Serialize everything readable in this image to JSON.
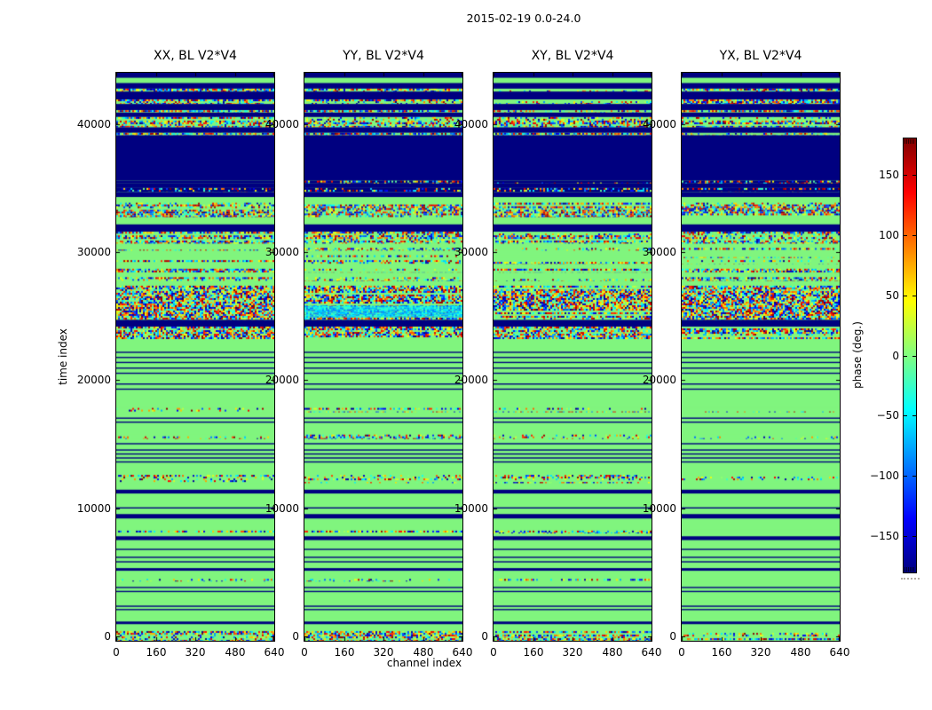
{
  "figure": {
    "title": "2015-02-19 0.0-24.0",
    "xlabel": "channel index",
    "ylabel": "time index"
  },
  "chart_data": {
    "type": "heatmap",
    "title": "2015-02-19 0.0-24.0",
    "xlabel": "channel index",
    "ylabel": "time index",
    "xlim": [
      0,
      640
    ],
    "ylim": [
      0,
      44000
    ],
    "x_ticks": [
      0,
      160,
      320,
      480,
      640
    ],
    "y_ticks": [
      0,
      10000,
      20000,
      30000,
      40000
    ],
    "grid": false,
    "panels": [
      {
        "label": "XX, BL V2*V4",
        "seed": 101
      },
      {
        "label": "YY, BL V2*V4",
        "seed": 202
      },
      {
        "label": "XY, BL V2*V4",
        "seed": 303
      },
      {
        "label": "YX, BL V2*V4",
        "seed": 404
      }
    ],
    "colorbar": {
      "label": "phase (deg.)",
      "vmin": -180,
      "vmax": 180,
      "ticks": [
        150,
        100,
        50,
        0,
        -50,
        -100,
        -150
      ],
      "colormap": "jet"
    },
    "colors": {
      "phase_zero_green": "#80f57e",
      "phase_neg180_navy": "#000080"
    },
    "bands": [
      {
        "t0": 43850,
        "t1": 44250,
        "type": "blue"
      },
      {
        "t0": 43450,
        "t1": 43850,
        "type": "green"
      },
      {
        "t0": 43010,
        "t1": 43450,
        "type": "blue"
      },
      {
        "t0": 42790,
        "t1": 43010,
        "type": "speckle"
      },
      {
        "t0": 42170,
        "t1": 42790,
        "type": "blue"
      },
      {
        "t0": 41820,
        "t1": 42170,
        "type": "speckle"
      },
      {
        "t0": 41330,
        "t1": 41820,
        "type": "blue"
      },
      {
        "t0": 41150,
        "t1": 41330,
        "type": "speckle"
      },
      {
        "t0": 40800,
        "t1": 41150,
        "type": "blue"
      },
      {
        "t0": 40000,
        "t1": 40800,
        "type": "speckle"
      },
      {
        "t0": 39560,
        "t1": 40000,
        "type": "blue"
      },
      {
        "t0": 39380,
        "t1": 39560,
        "type": "speckle"
      },
      {
        "t0": 35840,
        "t1": 39380,
        "type": "blue"
      },
      {
        "t0": 35620,
        "t1": 35840,
        "type": "speckle_blue"
      },
      {
        "t0": 35270,
        "t1": 35620,
        "type": "blue"
      },
      {
        "t0": 34960,
        "t1": 35270,
        "type": "speckle_blue"
      },
      {
        "t0": 34560,
        "t1": 34960,
        "type": "blue"
      },
      {
        "t0": 34120,
        "t1": 34560,
        "type": "green"
      },
      {
        "t0": 32970,
        "t1": 34120,
        "type": "speckle_heavy"
      },
      {
        "t0": 32440,
        "t1": 32970,
        "type": "green"
      },
      {
        "t0": 31860,
        "t1": 32440,
        "type": "blue"
      },
      {
        "t0": 30930,
        "t1": 31860,
        "type": "speckle"
      },
      {
        "t0": 30600,
        "t1": 30930,
        "type": "green"
      },
      {
        "t0": 30380,
        "t1": 30600,
        "type": "speckle_sparse"
      },
      {
        "t0": 30030,
        "t1": 30380,
        "type": "green"
      },
      {
        "t0": 29810,
        "t1": 30030,
        "type": "speckle_sparse"
      },
      {
        "t0": 29650,
        "t1": 29810,
        "type": "green"
      },
      {
        "t0": 29340,
        "t1": 29650,
        "type": "speckle"
      },
      {
        "t0": 28980,
        "t1": 29340,
        "type": "green"
      },
      {
        "t0": 28670,
        "t1": 28980,
        "type": "speckle"
      },
      {
        "t0": 28320,
        "t1": 28670,
        "type": "green"
      },
      {
        "t0": 28010,
        "t1": 28320,
        "type": "speckle"
      },
      {
        "t0": 27660,
        "t1": 28010,
        "type": "green"
      },
      {
        "t0": 25000,
        "t1": 27660,
        "type": "speckle_heavy"
      },
      {
        "t0": 24470,
        "t1": 25000,
        "type": "blue"
      },
      {
        "t0": 23500,
        "t1": 24470,
        "type": "speckle_heavy"
      },
      {
        "t0": 18140,
        "t1": 23500,
        "type": "green",
        "lines": [
          22520,
          22120,
          21730,
          21290,
          20890,
          20050,
          19650
        ]
      },
      {
        "t0": 17790,
        "t1": 18140,
        "type": "speckle_sparse"
      },
      {
        "t0": 16060,
        "t1": 17790,
        "type": "green",
        "lines": [
          17390,
          17080
        ]
      },
      {
        "t0": 15710,
        "t1": 16060,
        "type": "speckle_sparse"
      },
      {
        "t0": 12920,
        "t1": 15710,
        "type": "green",
        "lines": [
          15400,
          14910,
          14600,
          14290,
          13980
        ]
      },
      {
        "t0": 12260,
        "t1": 12920,
        "type": "speckle_sparse"
      },
      {
        "t0": 11770,
        "t1": 12260,
        "type": "green"
      },
      {
        "t0": 11460,
        "t1": 11770,
        "type": "blue"
      },
      {
        "t0": 9870,
        "t1": 11460,
        "type": "green",
        "lines": [
          10400
        ]
      },
      {
        "t0": 9510,
        "t1": 9870,
        "type": "blue"
      },
      {
        "t0": 8580,
        "t1": 9510,
        "type": "green"
      },
      {
        "t0": 8360,
        "t1": 8580,
        "type": "speckle_sparse"
      },
      {
        "t0": 8140,
        "t1": 8360,
        "type": "green"
      },
      {
        "t0": 7830,
        "t1": 8140,
        "type": "blue"
      },
      {
        "t0": 5660,
        "t1": 7830,
        "type": "green",
        "lines": [
          7170,
          6550,
          6200
        ]
      },
      {
        "t0": 5440,
        "t1": 5660,
        "type": "blue"
      },
      {
        "t0": 4820,
        "t1": 5440,
        "type": "green"
      },
      {
        "t0": 4600,
        "t1": 4820,
        "type": "speckle_sparse"
      },
      {
        "t0": 1500,
        "t1": 4600,
        "type": "green",
        "lines": [
          4200,
          3890,
          2740,
          2480
        ]
      },
      {
        "t0": 1280,
        "t1": 1500,
        "type": "blue"
      },
      {
        "t0": 750,
        "t1": 1280,
        "type": "green"
      },
      {
        "t0": 0,
        "t1": 750,
        "type": "speckle"
      }
    ],
    "panel_overrides": [
      {
        "panel": "YY, BL V2*V4",
        "bands": [
          {
            "t0": 25200,
            "t1": 26100,
            "type": "cyan"
          }
        ]
      }
    ]
  }
}
